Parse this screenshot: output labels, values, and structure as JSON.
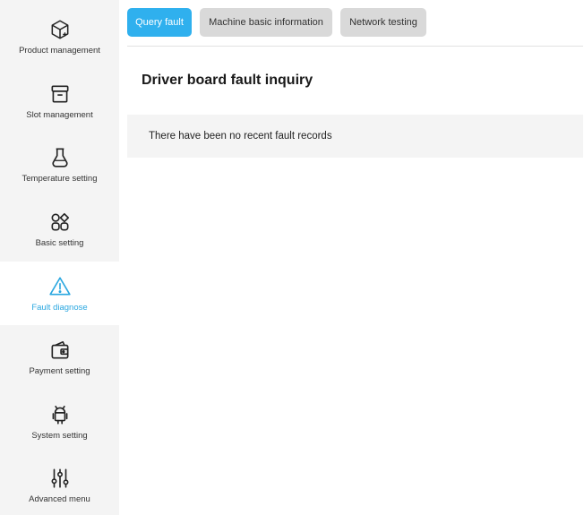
{
  "sidebar": {
    "items": [
      {
        "label": "Product management",
        "icon": "box-plus-icon"
      },
      {
        "label": "Slot management",
        "icon": "drawer-icon"
      },
      {
        "label": "Temperature setting",
        "icon": "temperature-flask-icon"
      },
      {
        "label": "Basic setting",
        "icon": "grid-shapes-icon"
      },
      {
        "label": "Fault diagnose",
        "icon": "warning-triangle-icon",
        "active": true
      },
      {
        "label": "Payment setting",
        "icon": "wallet-icon"
      },
      {
        "label": "System setting",
        "icon": "android-icon"
      },
      {
        "label": "Advanced menu",
        "icon": "sliders-icon"
      }
    ],
    "accent_color": "#2aa7e0"
  },
  "tabs": [
    {
      "label": "Query fault",
      "active": true
    },
    {
      "label": "Machine basic information"
    },
    {
      "label": "Network testing"
    }
  ],
  "main": {
    "title": "Driver board fault inquiry",
    "empty_message": "There have been no recent fault records"
  },
  "colors": {
    "tab_active": "#2fb0ee",
    "tab_inactive": "#d9d9d9",
    "sidebar_bg": "#f4f4f4"
  }
}
